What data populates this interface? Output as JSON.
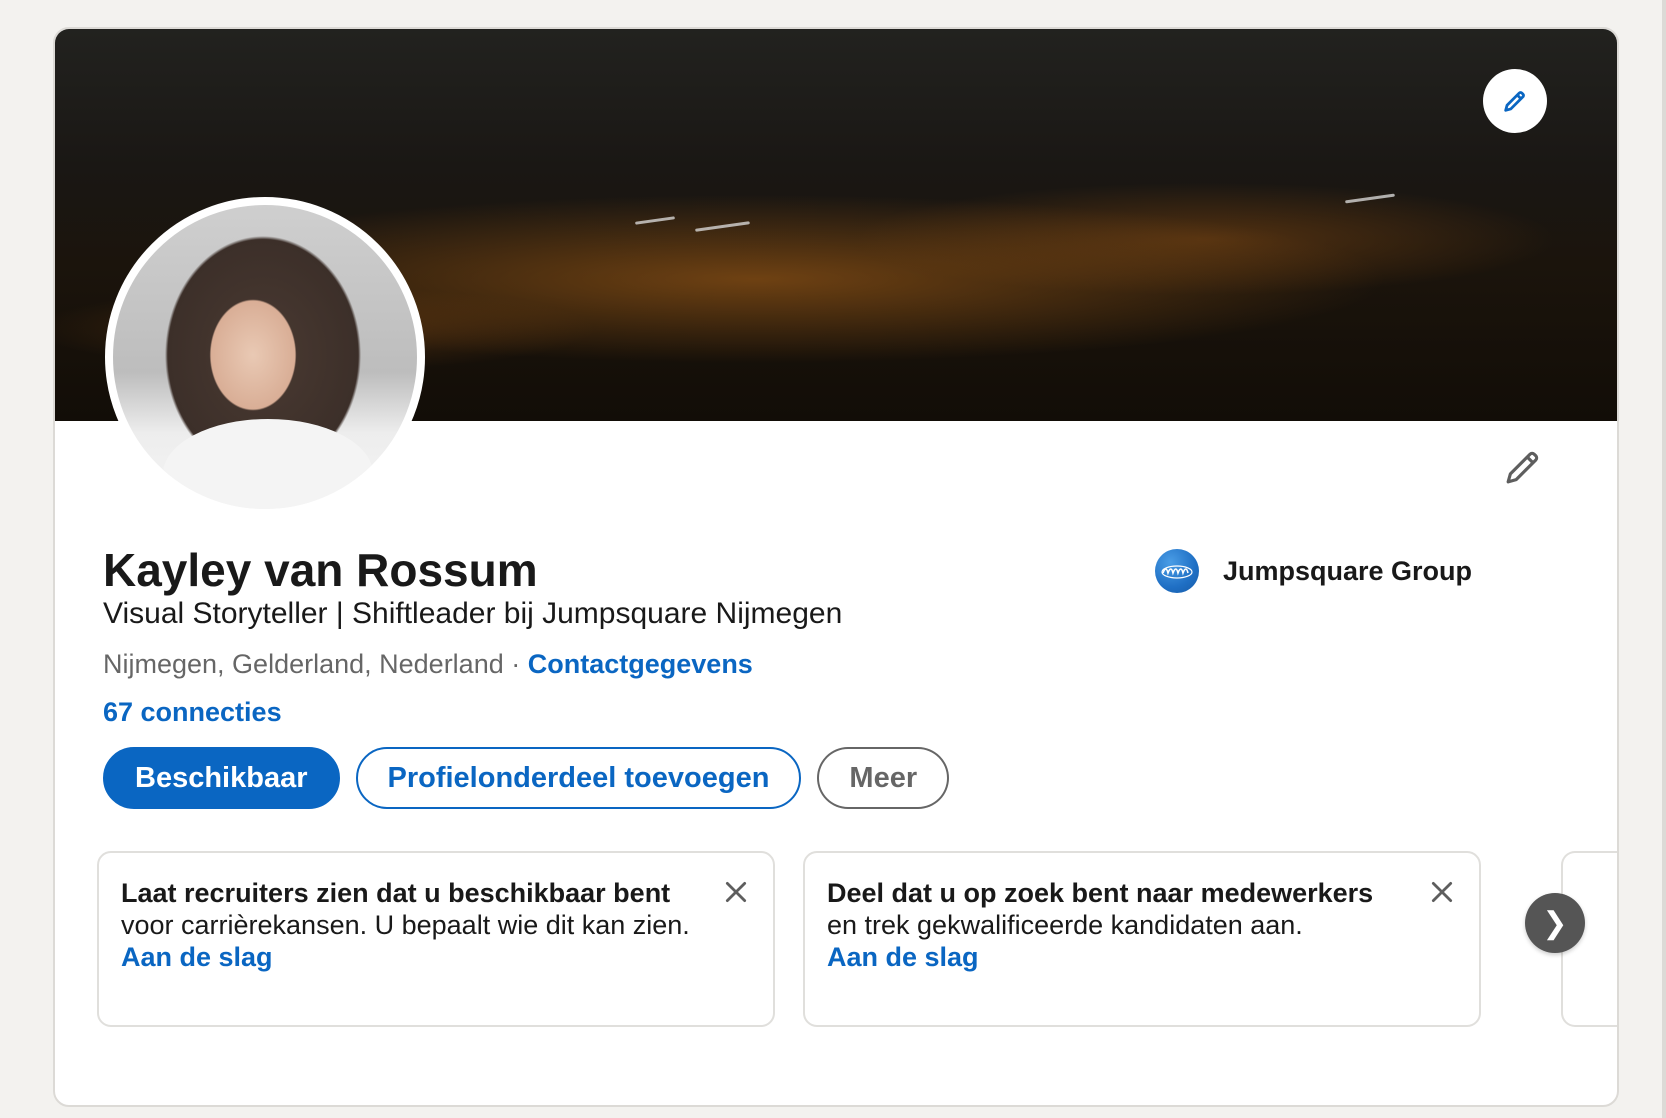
{
  "profile": {
    "name": "Kayley van Rossum",
    "headline": "Visual Storyteller | Shiftleader bij Jumpsquare Nijmegen",
    "location": "Nijmegen, Gelderland, Nederland",
    "separator": "·",
    "contact_link": "Contactgegevens",
    "connections": "67 connecties"
  },
  "company": {
    "name": "Jumpsquare Group"
  },
  "actions": {
    "primary": "Beschikbaar",
    "add_section": "Profielonderdeel toevoegen",
    "more": "Meer"
  },
  "tips": [
    {
      "bold": "Laat recruiters zien dat u beschikbaar bent",
      "text": " voor carrièrekansen. U bepaalt wie dit kan zien.",
      "cta": "Aan de slag"
    },
    {
      "bold": "Deel dat u op zoek bent naar medewerkers",
      "text": " en trek gekwalificeerde kandidaten aan.",
      "cta": "Aan de slag"
    }
  ],
  "icons": {
    "banner_edit": "pencil-icon",
    "intro_edit": "pencil-icon",
    "close": "close-icon",
    "next": "chevron-right-icon"
  },
  "colors": {
    "brand": "#0a66c2",
    "background": "#f3f2ef",
    "carousel_button": "#555555"
  },
  "carousel": {
    "next_glyph": "❯"
  }
}
